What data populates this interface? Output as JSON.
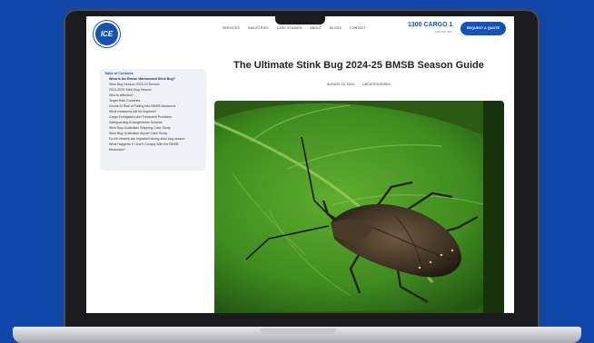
{
  "header": {
    "logo_text": "ICE",
    "nav": [
      "SERVICES",
      "INDUSTRIES",
      "CASE STUDIES",
      "ABOUT",
      "BLOGS",
      "CONTACT"
    ],
    "phone": "1300 CARGO 1",
    "phone_sub": "1300 227 461",
    "quote_button": "REQUEST A QUOTE"
  },
  "toc": {
    "title": "Table of Contents",
    "items": [
      "What is the Brown Marmorated Stink Bug?",
      "Stink Bug Season 2023-24 Review",
      "2024-2025 Stink Bug Season",
      "Who is affected?",
      "Target Risk Countries",
      "Goods At Risk of Falling Into BMSB Measures",
      "What measures will be required?",
      "Cargo Fumigation and Treatment Providers",
      "Safeguarding Arrangements Scheme",
      "Stink Bug: Australian Shipping Case Study",
      "Stink Bug: Australian Airport Case Study",
      "Do Air vessels are impacted during stink bug season",
      "What Happens If I Don't Comply With the BMSB",
      "Measures?"
    ]
  },
  "article": {
    "title": "The Ultimate Stink Bug 2024-25 BMSB Season Guide",
    "date": "AUGUST 16, 2024",
    "category": "UNCATEGORISED"
  },
  "colors": {
    "background": "#1147a8",
    "brand_blue": "#1552b5"
  }
}
